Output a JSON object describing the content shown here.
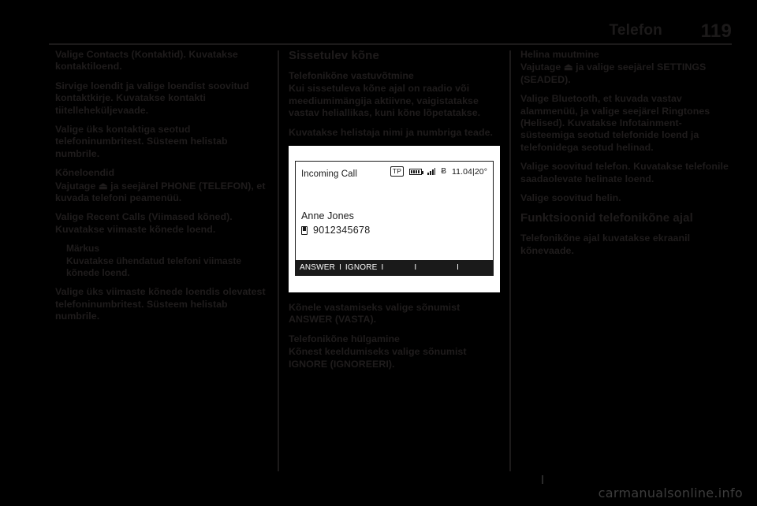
{
  "header": {
    "title": "Telefon",
    "page_number": "119"
  },
  "left_column": {
    "para_contacts": "Valige Contacts (Kontaktid). Kuvatakse kontaktiloend.",
    "para_browse": "Sirvige loendit ja valige loendist soovitud kontaktkirje. Kuvatakse kontakti tiitelleheküljevaade.",
    "para_select_number": "Valige üks kontaktiga seotud telefoninumbritest. Süsteem helistab numbrile.",
    "heading_call_lists": "Kõneloendid",
    "para_press_phone": "Vajutage ⏏ ja seejärel PHONE (TELEFON), et kuvada telefoni peamenüü.",
    "para_recent_calls": "Valige Recent Calls (Viimased kõned). Kuvatakse viimaste kõnede loend.",
    "note_title": "Märkus",
    "note_body": "Kuvatakse ühendatud telefoni viimaste kõnede loend.",
    "para_select_recent": "Valige üks viimaste kõnede loendis olevatest telefoninumbritest. Süsteem helistab numbrile."
  },
  "mid_column": {
    "heading_incoming": "Sissetulev kõne",
    "subheading_accept": "Telefonikõne vastuvõtmine",
    "para_accept_1": "Kui sissetuleva kõne ajal on raadio või meediumimängija aktiivne, vaigistatakse vastav heliallikas, kuni kõne lõpetatakse.",
    "para_accept_2": "Kuvatakse helistaja nimi ja numbriga teade.",
    "para_answer": "Kõnele vastamiseks valige sõnumist ANSWER (VASTA).",
    "subheading_reject": "Telefonikõne hülgamine",
    "para_reject": "Kõnest keeldumiseks valige sõnumist IGNORE (IGNOREERI).",
    "screen": {
      "title": "Incoming Call",
      "tp_badge": "TP",
      "clock": "11.04",
      "temperature": "20°",
      "clock_separator": "|",
      "caller_name": "Anne Jones",
      "caller_number": "9012345678",
      "softkey_answer": "ANSWER",
      "softkey_ignore": "IGNORE",
      "softkey_separator": "I",
      "icons": {
        "battery": "battery-icon",
        "signal": "signal-strength-icon",
        "bluetooth": "bluetooth-icon",
        "phone": "mobile-phone-icon"
      }
    }
  },
  "right_column": {
    "heading_ringtone": "Helina muutmine",
    "para_settings": "Vajutage ⏏ ja valige seejärel SETTINGS (SEADED).",
    "para_bluetooth": "Valige Bluetooth, et kuvada vastav alammenüü, ja valige seejärel Ringtones (Helised). Kuvatakse Infotainment-süsteemiga seotud telefonide loend ja telefonidega seotud helinad.",
    "para_select_phone": "Valige soovitud telefon. Kuvatakse telefonile saadaolevate helinate loend.",
    "para_select_tone": "Valige soovitud helin.",
    "heading_functions": "Funktsioonid telefonikõne ajal",
    "para_call_view": "Telefonikõne ajal kuvatakse ekraanil kõnevaade."
  },
  "watermark": "carmanualsonline.info"
}
